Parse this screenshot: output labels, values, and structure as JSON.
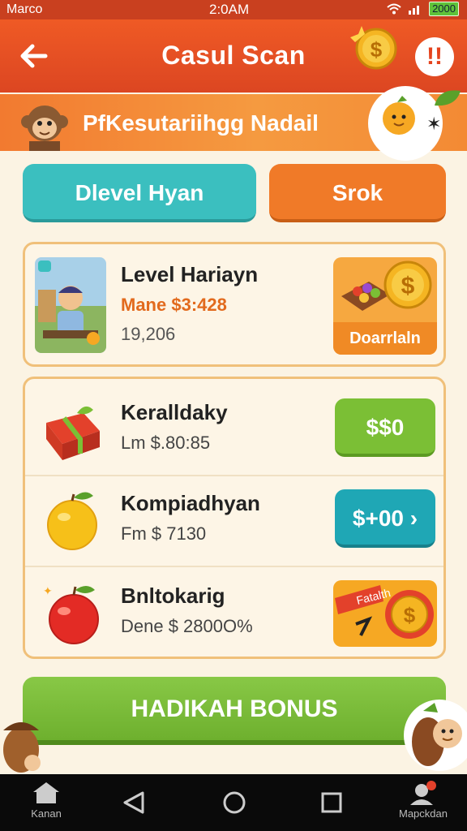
{
  "status_bar": {
    "carrier": "Marco",
    "time": "2:0AM",
    "battery": "2000"
  },
  "header": {
    "title": "Casul Scan",
    "alert": "!!"
  },
  "banner": {
    "text": "PfKesutariihgg Nadail"
  },
  "tabs": [
    {
      "label": "Dlevel Hyan"
    },
    {
      "label": "Srok"
    }
  ],
  "featured": {
    "title": "Level Hariayn",
    "price": "Mane $3:428",
    "count": "19,206",
    "action_label": "Doarrlaln"
  },
  "offers": [
    {
      "title": "Keralldaky",
      "subtitle": "Lm $.80:85",
      "button": "$$0",
      "icon": "gift-box-icon",
      "button_color": "#7bbf35"
    },
    {
      "title": "Kompiadhyan",
      "subtitle": "Fm $ 7130",
      "button": "$+00 ›",
      "icon": "orange-fruit-icon",
      "button_color": "#1fa7b5"
    },
    {
      "title": "Bnltokarig",
      "subtitle": "Dene $ 2800O%",
      "badge": "Fatalth",
      "icon": "apple-fruit-icon"
    }
  ],
  "bonus_button": {
    "label": "HADIKAH BONUS"
  },
  "nav": {
    "home": "Kanan",
    "profile": "Mapckdan"
  },
  "colors": {
    "header": "#e5431d",
    "banner": "#f38a34",
    "teal": "#3bbfbf",
    "orange": "#f07a28",
    "green": "#7bbf35"
  }
}
